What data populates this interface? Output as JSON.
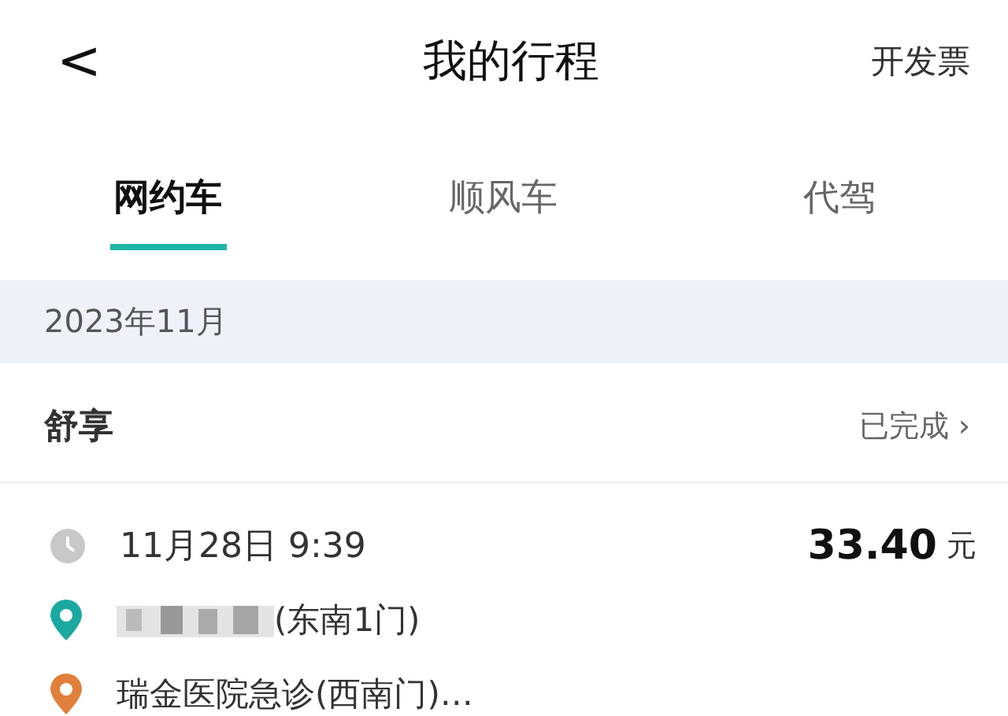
{
  "header": {
    "back": "<",
    "title": "我的行程",
    "action": "开发票"
  },
  "tabs": [
    {
      "label": "网约车",
      "selected": true
    },
    {
      "label": "顺风车",
      "selected": false
    },
    {
      "label": "代驾",
      "selected": false
    }
  ],
  "month": "2023年11月",
  "trip": {
    "service": "舒享",
    "status": "已完成",
    "chevron": "›",
    "time": "11月28日 9:39",
    "price": "33.40",
    "currency": "元",
    "stops": [
      {
        "text": "(东南1门)",
        "color": "#1aa8a0",
        "redacted": true
      },
      {
        "text": "瑞金医院急诊(西南门)…",
        "color": "#e0803a",
        "redacted": false
      }
    ]
  }
}
